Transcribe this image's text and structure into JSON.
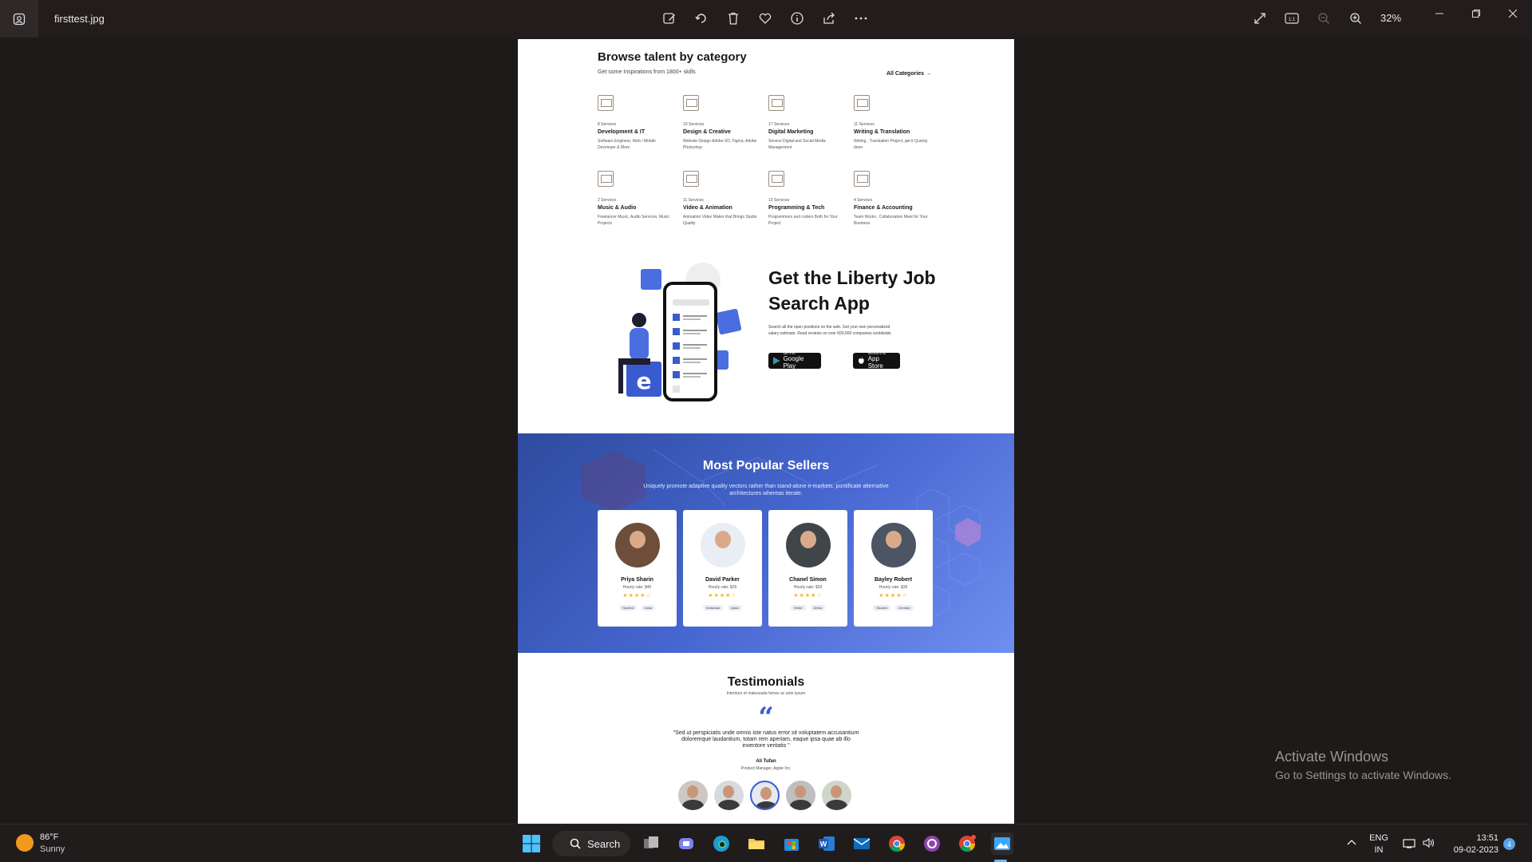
{
  "app": {
    "file_name": "firsttest.jpg",
    "zoom": "32%"
  },
  "toolbar": {
    "items": [
      "edit-image-icon",
      "rotate-icon",
      "delete-icon",
      "favorite-icon",
      "info-icon",
      "share-icon",
      "more-icon"
    ],
    "right": [
      "fullscreen-icon",
      "actual-size-icon",
      "zoom-out-icon",
      "zoom-in-icon"
    ]
  },
  "page": {
    "browse": {
      "title": "Browse talent by category",
      "subtitle": "Get some Inspirations from 1800+ skills",
      "all_link": "All Categories →",
      "categories": [
        {
          "services": "8 Services",
          "name": "Development & IT",
          "desc": "Software Engineer, Web / Mobile Developer & More"
        },
        {
          "services": "10 Services",
          "name": "Design & Creative",
          "desc": "Website Design Adobe XD, Figma, Adobe Photoshop"
        },
        {
          "services": "17 Services",
          "name": "Digital Marketing",
          "desc": "Service Digital and Social Media Management"
        },
        {
          "services": "11 Services",
          "name": "Writing & Translation",
          "desc": "Writing , Translation Project, get it Quickly done"
        },
        {
          "services": "2 Services",
          "name": "Music & Audio",
          "desc": "Freelancer Music, Audio Services, Music Projects"
        },
        {
          "services": "11 Services",
          "name": "Video & Animation",
          "desc": "Animation Video Maker that Brings Studio Quality"
        },
        {
          "services": "13 Services",
          "name": "Programming & Tech",
          "desc": "Programmers and coders Both for Your Project"
        },
        {
          "services": "4 Services",
          "name": "Finance & Accounting",
          "desc": "Team Works , Collaboration Meet for Your Business"
        }
      ]
    },
    "promo": {
      "title": "Get the Liberty Job Search App",
      "text": "Search all the open positions on the web. Get your own personalized salary estimate. Read reviews on over 600,000 companies worldwide.",
      "google_play_small": "GET IT ON",
      "google_play": "Google Play",
      "app_store_small": "Download on the",
      "app_store": "App Store"
    },
    "sellers": {
      "title": "Most Popular Sellers",
      "subtitle": "Uniquely promote adaptive quality vectors rather than stand-alone e-markets. pontificate alternative architectures whereas iterate.",
      "cards": [
        {
          "name": "Priya Sharin",
          "rate": "Hourly rate: $40",
          "stars": "★★★★☆",
          "tags": [
            "Student",
            "India"
          ]
        },
        {
          "name": "David Parker",
          "rate": "Hourly rate: $25",
          "stars": "★★★★☆",
          "tags": [
            "Individual",
            "Qatar"
          ]
        },
        {
          "name": "Chanel Simon",
          "rate": "Hourly rate: $20",
          "stars": "★★★★☆",
          "tags": [
            "Writer",
            "Africa"
          ]
        },
        {
          "name": "Bayley Robert",
          "rate": "Hourly rate: $35",
          "stars": "★★★★☆",
          "tags": [
            "Student",
            "German"
          ]
        }
      ]
    },
    "testimonials": {
      "title": "Testimonials",
      "subtitle": "Interdum et malesuada fames ac ante ipsum",
      "quote_mark": "“",
      "quote": "\"Sed ut perspiciatis unde omnis iste natus error sit voluptatem accusantium doloremque laudantium, totam rem aperiam, eaque ipsa quae ab illo inventore veritatis \"",
      "name": "Ali Tufan",
      "role": "Product Manager, Apple Inc."
    }
  },
  "watermark": {
    "line1": "Activate Windows",
    "line2": "Go to Settings to activate Windows."
  },
  "taskbar": {
    "weather_temp": "86°F",
    "weather_cond": "Sunny",
    "search_label": "Search",
    "lang1": "ENG",
    "lang2": "IN",
    "time": "13:51",
    "date": "09-02-2023",
    "notifications": "4"
  },
  "colors": {
    "accent_blue": "#3a5bd0",
    "star": "#f3b51b",
    "window_bg": "#1f1a1a"
  }
}
